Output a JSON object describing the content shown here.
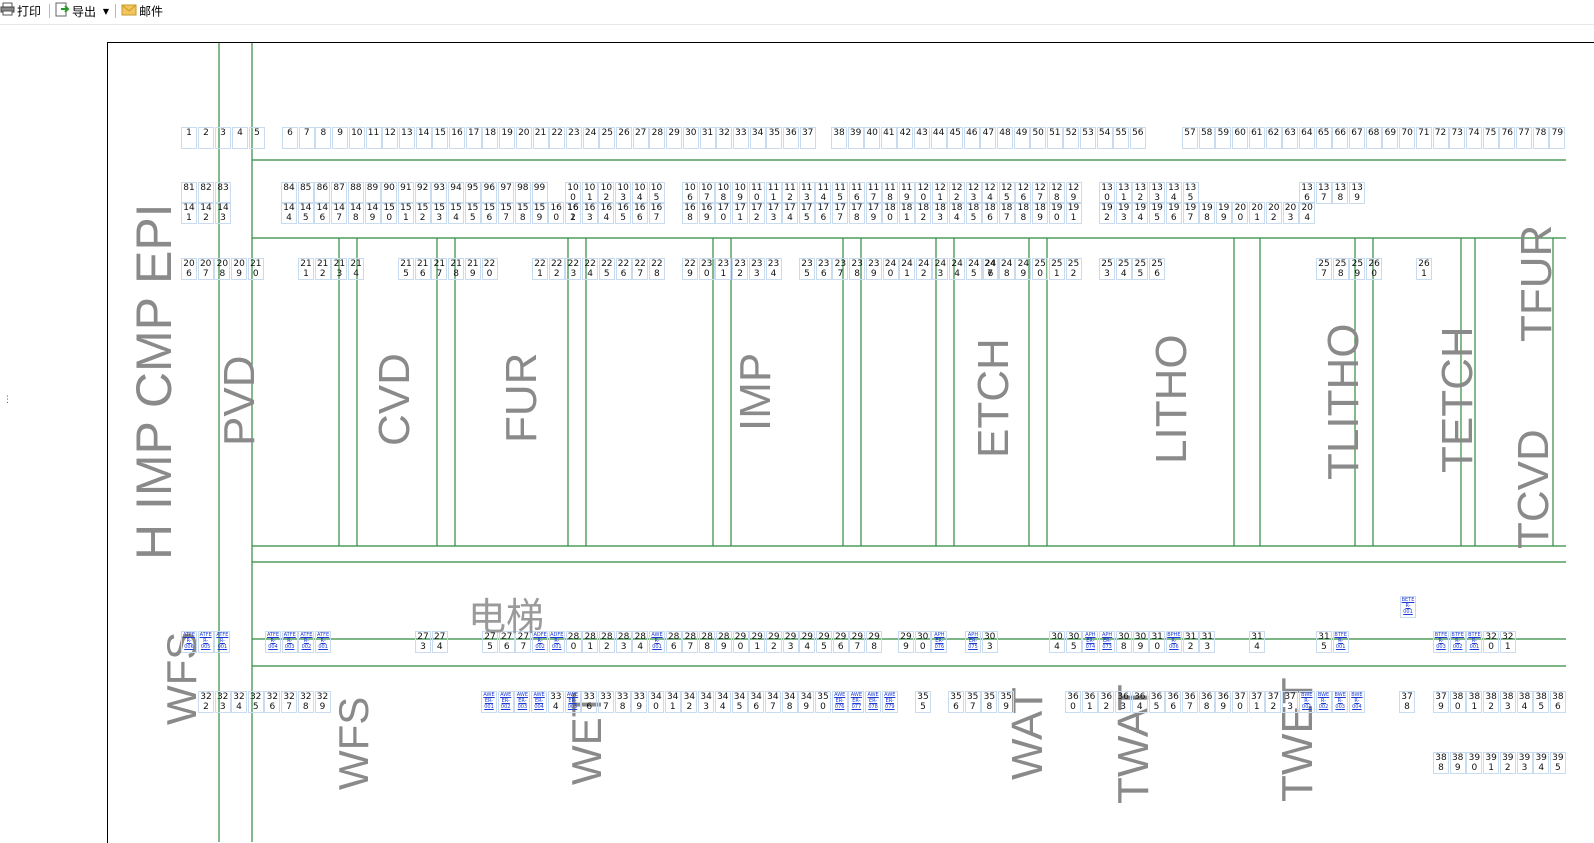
{
  "toolbar": {
    "print_label": "打印",
    "export_label": "导出",
    "mail_label": "邮件"
  },
  "colors": {
    "grid_line": "#2e8b3e",
    "cell_border": "#c9dcef",
    "link_text": "#1a39d6",
    "area_text": "#8a8a8a"
  },
  "elevator_label": "电梯",
  "splitter": "⋮",
  "areas": [
    "H IMP CMP EPI",
    "PVD",
    "CVD",
    "FUR",
    "IMP",
    "ETCH",
    "LITHO",
    "TLITHO",
    "TETCH",
    "TCVD",
    "TFUR",
    "WFS",
    "WFS",
    "WET",
    "WAT",
    "TWAT",
    "TWET"
  ],
  "row1": [
    "1",
    "2",
    "3",
    "4",
    "5",
    "6",
    "7",
    "8",
    "9",
    "10",
    "11",
    "12",
    "13",
    "14",
    "15",
    "16",
    "17",
    "18",
    "19",
    "20",
    "21",
    "22",
    "23",
    "24",
    "25",
    "26",
    "27",
    "28",
    "29",
    "30",
    "31",
    "32",
    "33",
    "34",
    "35",
    "36",
    "37",
    "38",
    "39",
    "40",
    "41",
    "42",
    "43",
    "44",
    "45",
    "46",
    "47",
    "48",
    "49",
    "50",
    "51",
    "52",
    "53",
    "54",
    "55",
    "56",
    "57",
    "58",
    "59",
    "60",
    "61",
    "62",
    "63",
    "64",
    "65",
    "66",
    "67",
    "68",
    "69",
    "70",
    "71",
    "72",
    "73",
    "74",
    "75",
    "76",
    "77",
    "78",
    "79"
  ],
  "row2a": [
    "81",
    "82",
    "83",
    "84",
    "85",
    "86",
    "87",
    "88",
    "89",
    "90",
    "91",
    "92",
    "93",
    "94",
    "95",
    "96",
    "97",
    "98",
    "99",
    "10\n0",
    "10\n1",
    "10\n2",
    "10\n3",
    "10\n4",
    "10\n5",
    "10\n6",
    "10\n7",
    "10\n8",
    "10\n9",
    "11\n0",
    "11\n1",
    "11\n2",
    "11\n3",
    "11\n4",
    "11\n5",
    "11\n6",
    "11\n7",
    "11\n8",
    "11\n9",
    "12\n0",
    "12\n1",
    "12\n2",
    "12\n3",
    "12\n4",
    "12\n5",
    "12\n6",
    "12\n7",
    "12\n8",
    "12\n9",
    "13\n0",
    "13\n1",
    "13\n2",
    "13\n3",
    "13\n4",
    "13\n5",
    "13\n6",
    "13\n7",
    "13\n8",
    "13\n9"
  ],
  "row2b": [
    "14\n1",
    "14\n2",
    "14\n3",
    "14\n4",
    "14\n5",
    "14\n6",
    "14\n7",
    "14\n8",
    "14\n9",
    "15\n0",
    "15\n1",
    "15\n2",
    "15\n3",
    "15\n4",
    "15\n5",
    "15\n6",
    "15\n7",
    "15\n8",
    "15\n9",
    "16\n0",
    "16\n1",
    "16\n2",
    "16\n3",
    "16\n4",
    "16\n5",
    "16\n6",
    "16\n7",
    "16\n8",
    "16\n9",
    "17\n0",
    "17\n1",
    "17\n2",
    "17\n3",
    "17\n4",
    "17\n5",
    "17\n6",
    "17\n7",
    "17\n8",
    "17\n9",
    "18\n0",
    "18\n1",
    "18\n2",
    "18\n3",
    "18\n4",
    "18\n5",
    "18\n6",
    "18\n7",
    "18\n8",
    "18\n9",
    "19\n0",
    "19\n1",
    "19\n2",
    "19\n3",
    "19\n4",
    "19\n5",
    "19\n6",
    "19\n7",
    "19\n8",
    "19\n9",
    "20\n0",
    "20\n1",
    "20\n2",
    "20\n3",
    "20\n4"
  ],
  "row3": [
    "20\n6",
    "20\n7",
    "20\n8",
    "20\n9",
    "21\n0",
    "21\n1",
    "21\n2",
    "21\n3",
    "21\n4",
    "21\n5",
    "21\n6",
    "21\n7",
    "21\n8",
    "21\n9",
    "22\n0",
    "22\n1",
    "22\n2",
    "22\n3",
    "22\n4",
    "22\n5",
    "22\n6",
    "22\n7",
    "22\n8",
    "22\n9",
    "23\n0",
    "23\n1",
    "23\n2",
    "23\n3",
    "23\n4",
    "23\n5",
    "23\n6",
    "23\n7",
    "23\n8",
    "23\n9",
    "24\n0",
    "24\n1",
    "24\n2",
    "24\n3",
    "24\n4",
    "24\n5",
    "24\n6",
    "24\n7",
    "24\n8",
    "24\n9",
    "25\n0",
    "25\n1",
    "25\n2",
    "25\n3",
    "25\n4",
    "25\n5",
    "25\n6",
    "25\n7",
    "25\n8",
    "25\n9",
    "26\n0",
    "26\n1"
  ],
  "row4": [
    "ATFE\nR-\n006",
    "ATFE\nR-\n005",
    "ATFE\nR-\n001",
    "ATFE\nR-\n004",
    "ATFE\nR-\n003",
    "ATFE\nR-\n002",
    "ATFE\nR-\n001",
    "27\n3",
    "27\n4",
    "27\n5",
    "27\n6",
    "27\n7",
    "ADFE\nR-\n002",
    "ADFE\nR-\n001",
    "28\n0",
    "28\n1",
    "28\n2",
    "28\n3",
    "28\n4",
    "AWE\nR-\n001",
    "28\n6",
    "28\n7",
    "28\n8",
    "28\n9",
    "29\n0",
    "29\n1",
    "29\n2",
    "29\n3",
    "29\n4",
    "29\n5",
    "29\n6",
    "29\n7",
    "29\n8",
    "29\n9",
    "30\n0",
    "APH\nER-\n076",
    "APH\nER-\n075",
    "30\n3",
    "30\n4",
    "30\n5",
    "APH\nER-\n074",
    "APH\nER-\n073",
    "30\n8",
    "30\n9",
    "31\n0",
    "BPHE\nR-\n006",
    "31\n2",
    "31\n3",
    "31\n4",
    "31\n5",
    "BTFE\nR-\n001",
    "BTFE\nR-\n003",
    "BTFE\nR-\n002",
    "BTFE\nR-\n001",
    "32\n0",
    "32\n1"
  ],
  "row4_extra": "BETE\nR-\n001",
  "row5": [
    "32\n2",
    "32\n3",
    "32\n4",
    "32\n5",
    "32\n6",
    "32\n7",
    "32\n8",
    "32\n9",
    "AWE\nER-\n001",
    "AWE\nER-\n002",
    "AWE\nER-\n003",
    "AWE\nER-\n004",
    "33\n4",
    "AWE\nER-\n005",
    "33\n6",
    "33\n7",
    "33\n8",
    "33\n9",
    "34\n0",
    "34\n1",
    "34\n2",
    "34\n3",
    "34\n4",
    "34\n5",
    "34\n6",
    "34\n7",
    "34\n8",
    "34\n9",
    "35\n0",
    "AWE\nER-\n076",
    "AWE\nER-\n077",
    "AWE\nER-\n078",
    "AWE\nER-\n079",
    "35\n5",
    "35\n6",
    "35\n7",
    "35\n8",
    "35\n9",
    "36\n0",
    "36\n1",
    "36\n2",
    "36\n3",
    "36\n4",
    "36\n5",
    "36\n6",
    "36\n7",
    "36\n8",
    "36\n9",
    "37\n0",
    "37\n1",
    "37\n2",
    "37\n3",
    "BWE\nR-\n001",
    "BWE\nR-\n002",
    "BWE\nR-\n003",
    "BWE\nR-\n004",
    "37\n8",
    "37\n9",
    "38\n0",
    "38\n1",
    "38\n2",
    "38\n3",
    "38\n4",
    "38\n5",
    "38\n6"
  ],
  "row6": [
    "38\n8",
    "38\n9",
    "39\n0",
    "39\n1",
    "39\n2",
    "39\n3",
    "39\n4",
    "39\n5"
  ]
}
